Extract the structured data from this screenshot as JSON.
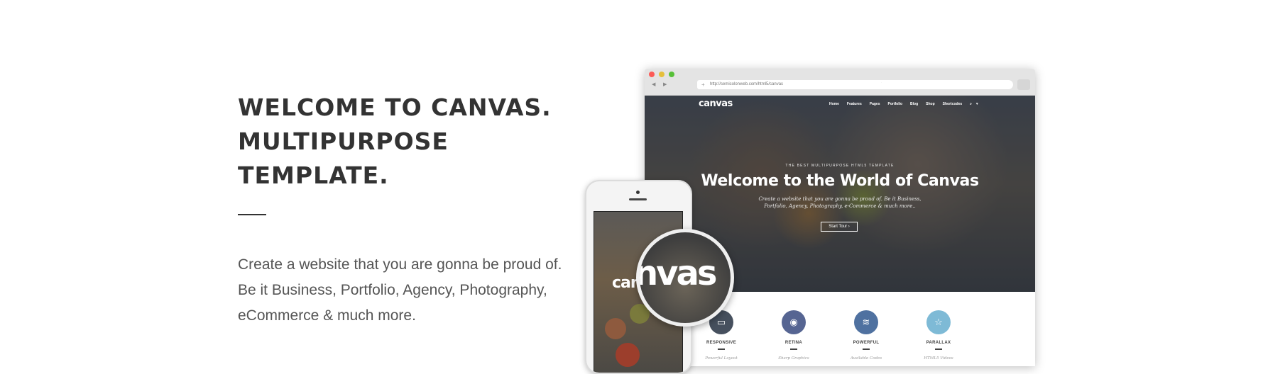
{
  "intro": {
    "heading_line1": "WELCOME TO CANVAS.",
    "heading_line2": "MULTIPURPOSE TEMPLATE.",
    "body": "Create a website that you are gonna be proud of. Be it Business, Portfolio, Agency, Photography, eCommerce & much more."
  },
  "browser": {
    "url": "http://semicolonweb.com/html5/canvas",
    "site_logo": "canvas",
    "nav": [
      "Home",
      "Features",
      "Pages",
      "Portfolio",
      "Blog",
      "Shop",
      "Shortcodes"
    ],
    "hero_kicker": "THE BEST MULTIPURPOSE HTML5 TEMPLATE",
    "hero_title": "Welcome to the World of Canvas",
    "hero_sub": "Create a website that you are gonna be proud of. Be it Business, Portfolio, Agency, Photography, e-Commerce & much more..",
    "hero_button": "Start Tour ›",
    "features": [
      {
        "icon": "monitor-icon",
        "label": "RESPONSIVE",
        "caption": "Powerful Layout",
        "color": "#46505e"
      },
      {
        "icon": "eye-icon",
        "label": "RETINA",
        "caption": "Sharp Graphics",
        "color": "#566592"
      },
      {
        "icon": "layers-icon",
        "label": "POWERFUL",
        "caption": "Available Codes",
        "color": "#4f71a0"
      },
      {
        "icon": "star-icon",
        "label": "PARALLAX",
        "caption": "HTML5 Videos",
        "color": "#7ebad6"
      }
    ]
  },
  "phone": {
    "screen_logo": "can"
  },
  "magnifier": {
    "text": "nvas"
  }
}
